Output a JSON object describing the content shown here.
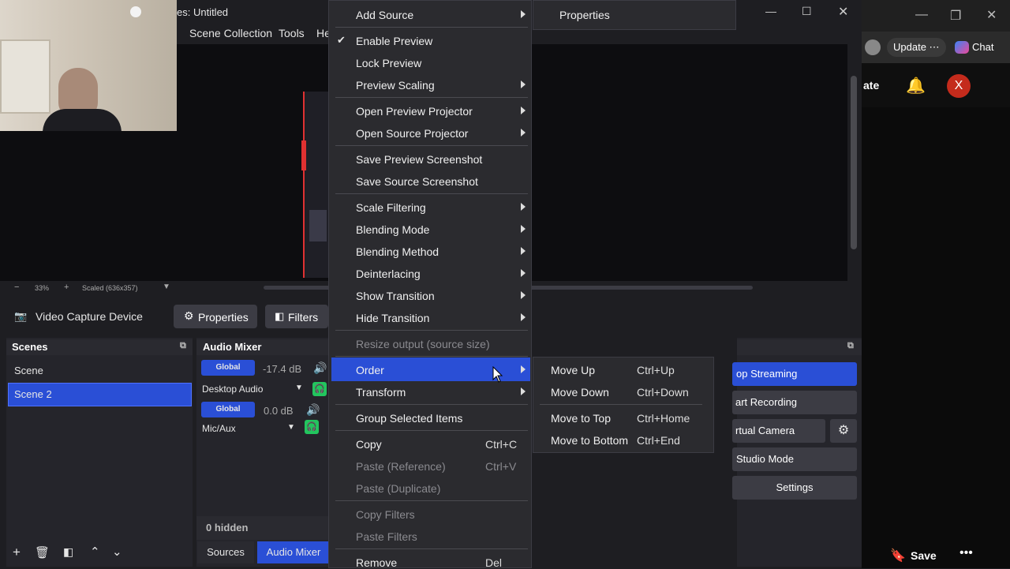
{
  "window": {
    "title": "es: Untitled"
  },
  "menu": {
    "scene_collection": "Scene Collection",
    "tools": "Tools",
    "help": "He"
  },
  "preview_bar": {
    "zoom": "33%",
    "scaled": "Scaled (636x357)"
  },
  "source_toolbar": {
    "source_name": "Video Capture Device",
    "properties": "Properties",
    "filters": "Filters"
  },
  "scenes": {
    "header": "Scenes",
    "items": [
      "Scene",
      "Scene 2"
    ],
    "selected": "Scene 2"
  },
  "audio_mixer": {
    "header": "Audio Mixer",
    "channels": [
      {
        "badge": "Global",
        "level": "-17.4 dB",
        "name": "Desktop Audio"
      },
      {
        "badge": "Global",
        "level": "0.0 dB",
        "name": "Mic/Aux"
      }
    ],
    "hidden": "0 hidden",
    "tabs": [
      "Sources",
      "Audio Mixer"
    ]
  },
  "controls": {
    "stop_streaming": "op Streaming",
    "start_recording": "art Recording",
    "virtual_camera": "rtual Camera",
    "studio_mode": "Studio Mode",
    "settings": "Settings"
  },
  "context_menu": {
    "add_source": "Add Source",
    "enable_preview": "Enable Preview",
    "lock_preview": "Lock Preview",
    "preview_scaling": "Preview Scaling",
    "open_preview_projector": "Open Preview Projector",
    "open_source_projector": "Open Source Projector",
    "save_preview_screenshot": "Save Preview Screenshot",
    "save_source_screenshot": "Save Source Screenshot",
    "scale_filtering": "Scale Filtering",
    "blending_mode": "Blending Mode",
    "blending_method": "Blending Method",
    "deinterlacing": "Deinterlacing",
    "show_transition": "Show Transition",
    "hide_transition": "Hide Transition",
    "resize_output": "Resize output (source size)",
    "order": "Order",
    "transform": "Transform",
    "group_selected": "Group Selected Items",
    "copy": "Copy",
    "copy_sc": "Ctrl+C",
    "paste_reference": "Paste (Reference)",
    "paste_reference_sc": "Ctrl+V",
    "paste_duplicate": "Paste (Duplicate)",
    "copy_filters": "Copy Filters",
    "paste_filters": "Paste Filters",
    "remove": "Remove",
    "remove_sc": "Del"
  },
  "add_source_submenu": {
    "properties": "Properties"
  },
  "order_submenu": [
    {
      "label": "Move Up",
      "shortcut": "Ctrl+Up"
    },
    {
      "label": "Move Down",
      "shortcut": "Ctrl+Down"
    },
    {
      "label": "Move to Top",
      "shortcut": "Ctrl+Home"
    },
    {
      "label": "Move to Bottom",
      "shortcut": "Ctrl+End"
    }
  ],
  "bg_app": {
    "update": "Update",
    "chat": "Chat",
    "ate": "ate",
    "avatar": "X",
    "save": "Save"
  },
  "colors": {
    "selection": "#2a4fd6",
    "accent_green": "#22c55e",
    "avatar_red": "#c42b1c"
  }
}
